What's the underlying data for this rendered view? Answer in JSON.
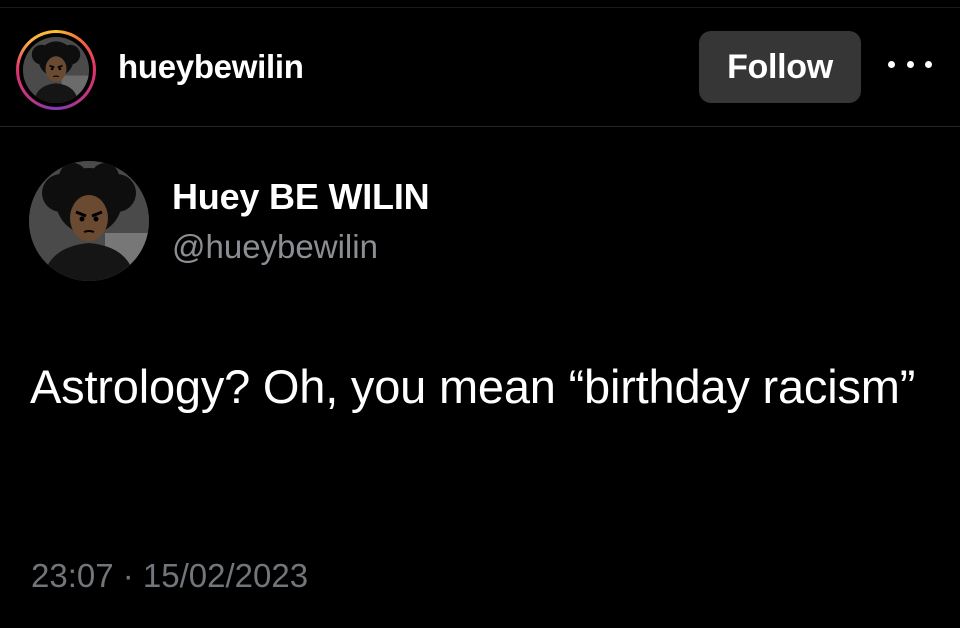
{
  "header": {
    "username": "hueybewilin",
    "follow_label": "Follow",
    "more_icon": "more-horizontal-icon",
    "ring_colors": [
      "#f9c12e",
      "#e1306c",
      "#833ab4"
    ]
  },
  "tweet": {
    "display_name": "Huey BE WILIN",
    "handle": "@hueybewilin",
    "text": "Astrology? Oh, you mean “birthday racism”",
    "timestamp": "23:07 · 15/02/2023"
  },
  "colors": {
    "background": "#000000",
    "follow_button": "#363636",
    "secondary_text": "#71767b"
  }
}
